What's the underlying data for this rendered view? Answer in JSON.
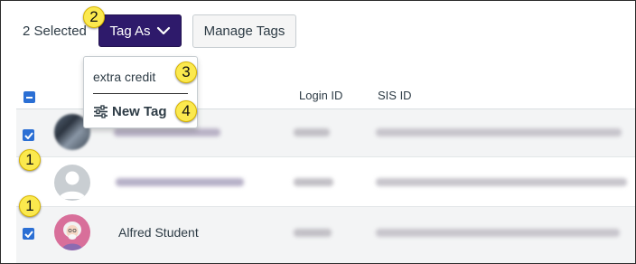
{
  "toolbar": {
    "selected_count": "2 Selected",
    "tag_as_label": "Tag As",
    "manage_tags_label": "Manage Tags"
  },
  "dropdown": {
    "existing_tag": "extra credit",
    "new_tag_label": "New Tag"
  },
  "callouts": {
    "tag_as": "2",
    "existing_tag": "3",
    "new_tag": "4",
    "row1": "1",
    "row3": "1"
  },
  "table": {
    "columns": [
      "",
      "",
      "Login ID",
      "SIS ID"
    ],
    "rows": [
      {
        "checked": true,
        "name": "",
        "avatar": "photo",
        "name_redacted": true
      },
      {
        "checked": false,
        "name": "",
        "avatar": "default-user",
        "name_redacted": true
      },
      {
        "checked": true,
        "name": "Alfred Student",
        "avatar": "student-illustration",
        "name_redacted": false
      }
    ]
  },
  "colors": {
    "primary_button": "#2e1a6b",
    "checkbox": "#2b6fd4",
    "callout_fill": "#fbe94e",
    "row_alt": "#f3f4f5"
  }
}
